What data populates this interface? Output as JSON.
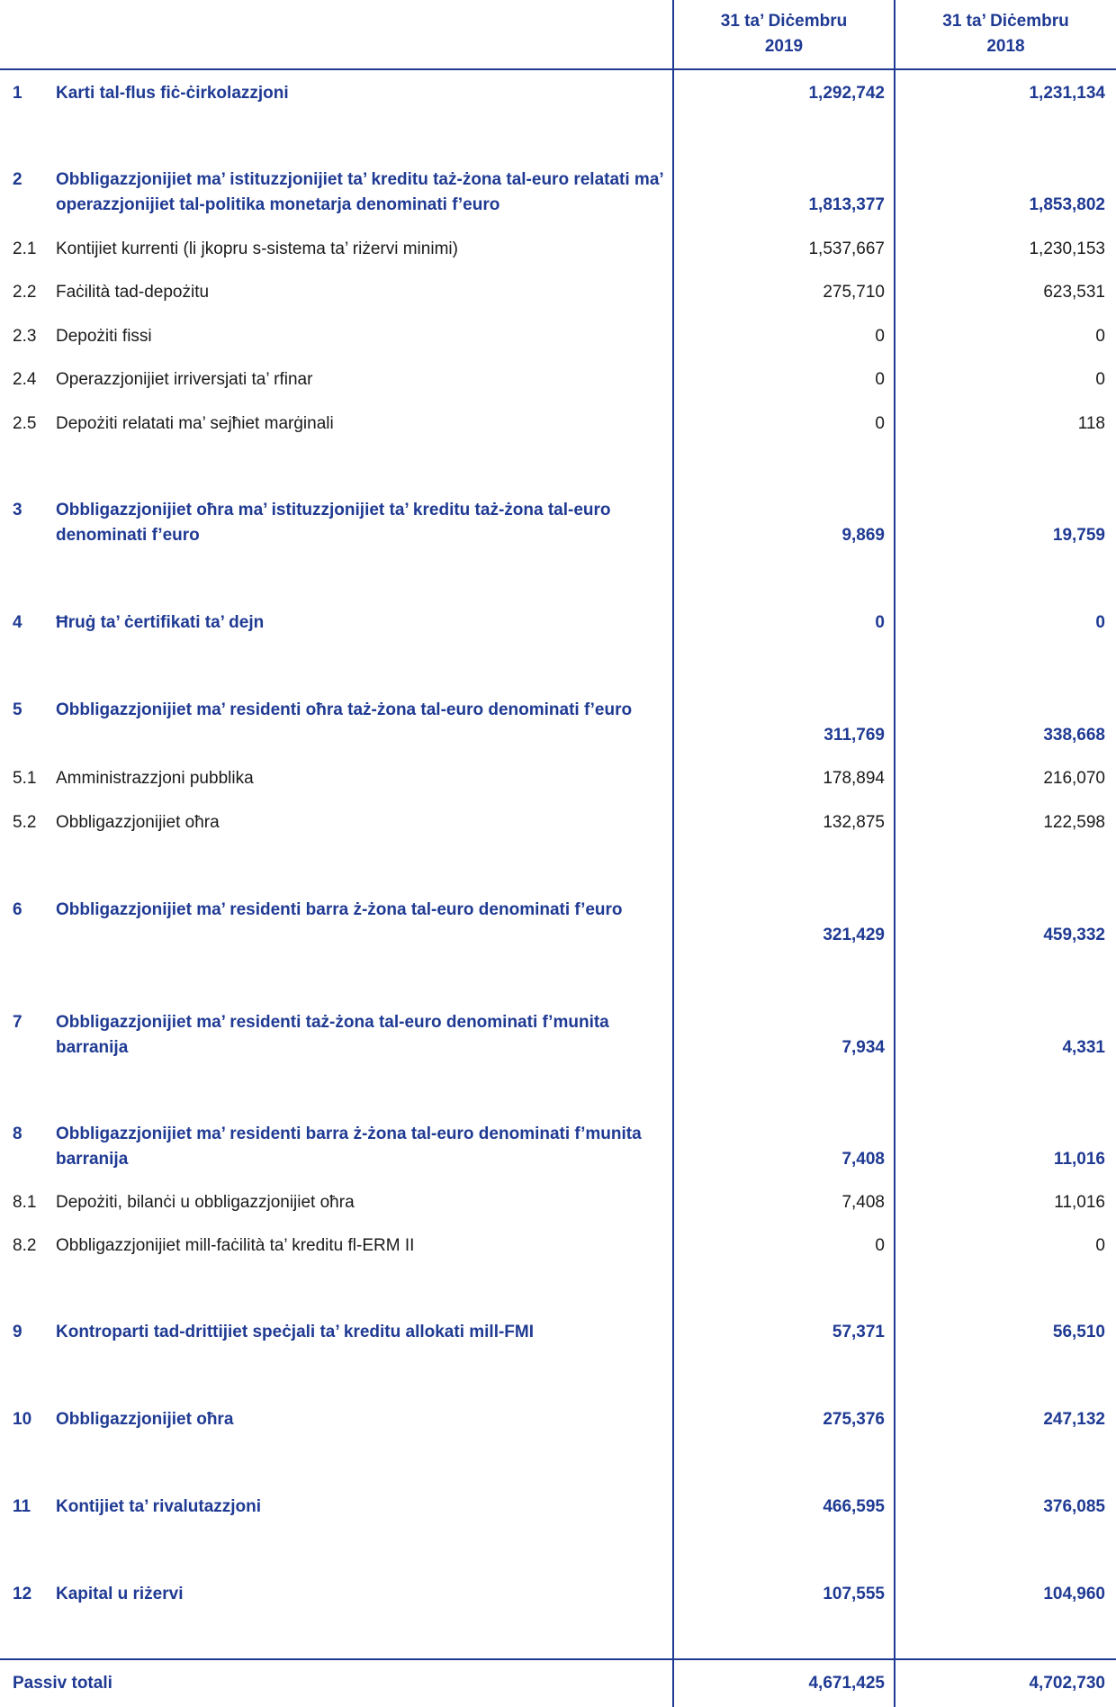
{
  "header": {
    "col1_line1": "31 ta’ Diċembru",
    "col1_line2": "2019",
    "col2_line1": "31 ta’ Diċembru",
    "col2_line2": "2018"
  },
  "rows": [
    {
      "num": "1",
      "label": "Karti tal-flus fiċ-ċirkolazzjoni",
      "v2019": "1,292,742",
      "v2018": "1,231,134",
      "bold": true
    },
    {
      "num": "2",
      "label": "Obbligazzjonijiet ma’ istituzzjonijiet ta’ kreditu taż-żona tal-euro relatati ma’ operazzjonijiet tal-politika monetarja denominati f’euro",
      "v2019": "1,813,377",
      "v2018": "1,853,802",
      "bold": true
    },
    {
      "num": "2.1",
      "label": "Kontijiet kurrenti (li jkopru s-sistema ta’ riżervi minimi)",
      "v2019": "1,537,667",
      "v2018": "1,230,153",
      "bold": false
    },
    {
      "num": "2.2",
      "label": "Faċilità tad-depożitu",
      "v2019": "275,710",
      "v2018": "623,531",
      "bold": false
    },
    {
      "num": "2.3",
      "label": "Depożiti fissi",
      "v2019": "0",
      "v2018": "0",
      "bold": false
    },
    {
      "num": "2.4",
      "label": "Operazzjonijiet irriversjati ta’ rfinar",
      "v2019": "0",
      "v2018": "0",
      "bold": false
    },
    {
      "num": "2.5",
      "label": "Depożiti relatati ma’ sejħiet marġinali",
      "v2019": "0",
      "v2018": "118",
      "bold": false
    },
    {
      "num": "3",
      "label": "Obbligazzjonijiet oħra ma’ istituzzjonijiet ta’ kreditu taż-żona tal-euro denominati f’euro",
      "v2019": "9,869",
      "v2018": "19,759",
      "bold": true
    },
    {
      "num": "4",
      "label": "Ħruġ ta’ ċertifikati ta’ dejn",
      "v2019": "0",
      "v2018": "0",
      "bold": true
    },
    {
      "num": "5",
      "label": "Obbligazzjonijiet ma’ residenti oħra taż-żona tal-euro denominati f’euro",
      "v2019": "311,769",
      "v2018": "338,668",
      "bold": true
    },
    {
      "num": "5.1",
      "label": "Amministrazzjoni pubblika",
      "v2019": "178,894",
      "v2018": "216,070",
      "bold": false
    },
    {
      "num": "5.2",
      "label": "Obbligazzjonijiet oħra",
      "v2019": "132,875",
      "v2018": "122,598",
      "bold": false
    },
    {
      "num": "6",
      "label": "Obbligazzjonijiet ma’ residenti barra ż-żona tal-euro denominati f’euro",
      "v2019": "321,429",
      "v2018": "459,332",
      "bold": true
    },
    {
      "num": "7",
      "label": "Obbligazzjonijiet ma’ residenti taż-żona tal-euro denominati f’munita barranija",
      "v2019": "7,934",
      "v2018": "4,331",
      "bold": true
    },
    {
      "num": "8",
      "label": "Obbligazzjonijiet ma’ residenti barra ż-żona tal-euro denominati f’munita barranija",
      "v2019": "7,408",
      "v2018": "11,016",
      "bold": true
    },
    {
      "num": "8.1",
      "label": "Depożiti, bilanċi u obbligazzjonijiet oħra",
      "v2019": "7,408",
      "v2018": "11,016",
      "bold": false
    },
    {
      "num": "8.2",
      "label": "Obbligazzjonijiet mill-faċilità ta’ kreditu fl-ERM II",
      "v2019": "0",
      "v2018": "0",
      "bold": false
    },
    {
      "num": "9",
      "label": "Kontroparti tad-drittijiet speċjali ta’ kreditu allokati mill-FMI",
      "v2019": "57,371",
      "v2018": "56,510",
      "bold": true
    },
    {
      "num": "10",
      "label": "Obbligazzjonijiet oħra",
      "v2019": "275,376",
      "v2018": "247,132",
      "bold": true
    },
    {
      "num": "11",
      "label": "Kontijiet ta’ rivalutazzjoni",
      "v2019": "466,595",
      "v2018": "376,085",
      "bold": true
    },
    {
      "num": "12",
      "label": "Kapital u riżervi",
      "v2019": "107,555",
      "v2018": "104,960",
      "bold": true
    }
  ],
  "total": {
    "label": "Passiv totali",
    "v2019": "4,671,425",
    "v2018": "4,702,730"
  }
}
